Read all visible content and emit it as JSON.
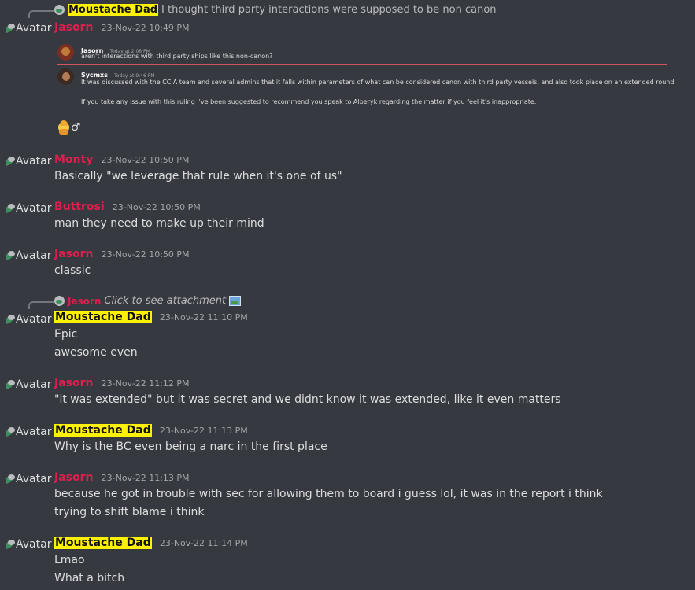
{
  "avatar_label": "Avatar",
  "messages": [
    {
      "reply": {
        "name": "Moustache Dad",
        "text": "I thought third party interactions were supposed to be non canon"
      },
      "author": "Jasorn",
      "timestamp": "23-Nov-22 10:49 PM",
      "embed": {
        "msg1": {
          "name": "Jasorn",
          "time": "Today at 2:06 PM",
          "text": "aren't interactions with third party ships like this non-canon?"
        },
        "msg2": {
          "name": "Sycmxs",
          "time": "Today at 9:46 PM",
          "line1": "It was discussed with the CCIA team and several admins that it falls within parameters of what can be considered canon with third party vessels, and also took place on an extended round.",
          "line2": "If you take any issue with this ruling I've been suggested to recommend you speak to Alberyk regarding the matter if you feel it's inappropriate."
        }
      },
      "emoji_suffix": "♂"
    },
    {
      "author": "Monty",
      "timestamp": "23-Nov-22 10:50 PM",
      "lines": [
        "Basically \"we leverage that rule when it's one of us\""
      ]
    },
    {
      "author": "Buttrosi",
      "timestamp": "23-Nov-22 10:50 PM",
      "lines": [
        "man they need to make up their mind"
      ]
    },
    {
      "author": "Jasorn",
      "timestamp": "23-Nov-22 10:50 PM",
      "lines": [
        "classic"
      ]
    },
    {
      "reply": {
        "name": "Jasorn",
        "text": "Click to see attachment"
      },
      "author": "Moustache Dad",
      "timestamp": "23-Nov-22 11:10 PM",
      "lines": [
        "Epic",
        "awesome even"
      ]
    },
    {
      "author": "Jasorn",
      "timestamp": "23-Nov-22 11:12 PM",
      "lines": [
        "\"it was extended\" but it was secret and we didnt know it was extended, like it even matters"
      ]
    },
    {
      "author": "Moustache Dad",
      "timestamp": "23-Nov-22 11:13 PM",
      "lines": [
        "Why is the BC even being a narc in the first place"
      ]
    },
    {
      "author": "Jasorn",
      "timestamp": "23-Nov-22 11:13 PM",
      "lines": [
        "because he got in trouble with sec for allowing them to board i guess lol, it was in the report i think",
        "trying to shift blame i think"
      ]
    },
    {
      "author": "Moustache Dad",
      "timestamp": "23-Nov-22 11:14 PM",
      "lines": [
        "Lmao",
        "What a bitch"
      ]
    }
  ],
  "colors": {
    "background": "#36393f",
    "username_red": "#e01e4e",
    "highlight_yellow": "#fff200"
  }
}
